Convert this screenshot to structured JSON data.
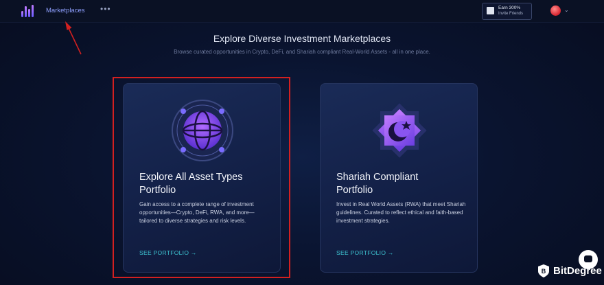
{
  "topbar": {
    "nav_label": "Marketplaces",
    "more_label": "•••",
    "invite_line1": "Earn 300%",
    "invite_line2": "Invite Friends"
  },
  "header": {
    "title": "Explore Diverse Investment Marketplaces",
    "subtitle": "Browse curated opportunities in Crypto, DeFi, and Shariah compliant Real-World Assets - all in one place."
  },
  "cards": [
    {
      "title": "Explore All Asset Types\nPortfolio",
      "description": "Gain access to a complete range of investment opportunities—Crypto, DeFi, RWA, and more—tailored to diverse strategies and risk levels.",
      "cta": "SEE PORTFOLIO →",
      "icon": "globe-icon"
    },
    {
      "title": "Shariah Compliant\nPortfolio",
      "description": "Invest in Real World Assets (RWA) that meet Shariah guidelines. Curated to reflect ethical and faith-based investment strategies.",
      "cta": "SEE PORTFOLIO →",
      "icon": "crescent-star-icon"
    }
  ],
  "watermark": {
    "brand": "BitDegree"
  },
  "colors": {
    "accent_cyan": "#3ec7d4",
    "nav_blue": "#8fa0ff",
    "highlight_red": "#d32020",
    "background": "#0a1430"
  }
}
